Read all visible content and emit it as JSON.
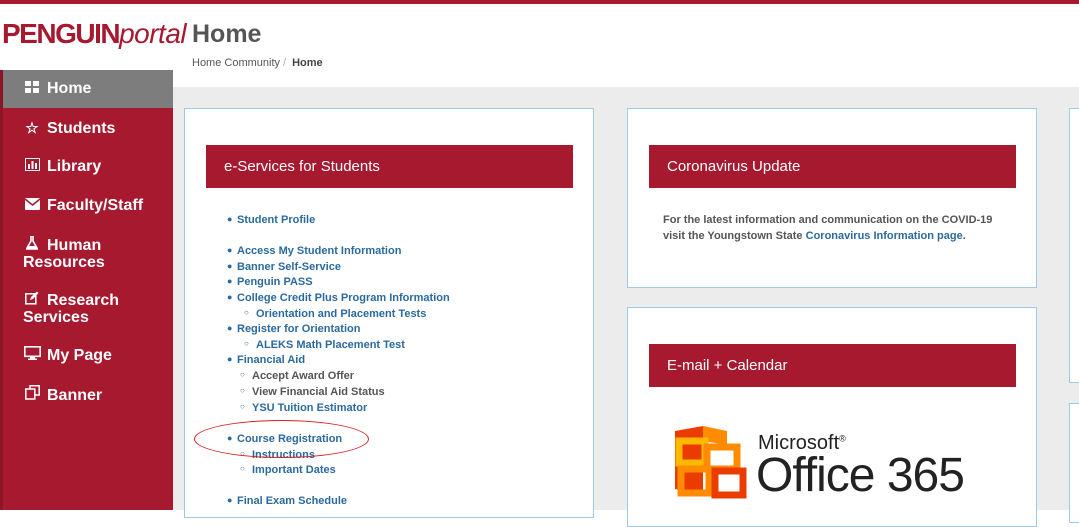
{
  "header": {
    "logo_bold": "PENGUIN",
    "logo_italic": "portal",
    "title": "Home",
    "breadcrumb_parent": "Home Community",
    "breadcrumb_sep": "/",
    "breadcrumb_current": "Home"
  },
  "sidebar": {
    "items": [
      {
        "label": "Home",
        "icon": "grid-icon"
      },
      {
        "label": "Students",
        "icon": "star-icon"
      },
      {
        "label": "Library",
        "icon": "chart-icon"
      },
      {
        "label": "Faculty/Staff",
        "icon": "envelope-icon"
      },
      {
        "label": "Human",
        "label2": "Resources",
        "icon": "flask-icon"
      },
      {
        "label": "Research",
        "label2": "Services",
        "icon": "edit-icon"
      },
      {
        "label": "My Page",
        "icon": "monitor-icon"
      },
      {
        "label": "Banner",
        "icon": "copy-icon"
      }
    ]
  },
  "eservices": {
    "title": "e-Services for Students",
    "links": [
      "Student Profile",
      "Access My Student Information",
      "Banner Self-Service",
      "Penguin PASS",
      "College Credit Plus Program Information",
      "Orientation and Placement Tests",
      "Register for Orientation",
      "ALEKS Math Placement Test",
      "Financial Aid",
      "Accept Award Offer",
      "View Financial Aid Status",
      "YSU Tuition Estimator",
      "Course Registration",
      "Instructions",
      "Important Dates",
      "Final Exam Schedule"
    ]
  },
  "covid": {
    "title": "Coronavirus Update",
    "text_line1": "For the latest information and communication on the COVID-19",
    "text_line2_prefix": "visit the Youngstown State",
    "link": "Coronavirus Information page",
    "text_suffix": "."
  },
  "email": {
    "title": "E-mail + Calendar",
    "ms_brand": "Microsoft",
    "ms_reg": "®",
    "ms_product": "Office 365"
  },
  "colors": {
    "accent": "#a6192e",
    "link": "#2a6a9e",
    "active_nav": "#7d7d7d"
  }
}
